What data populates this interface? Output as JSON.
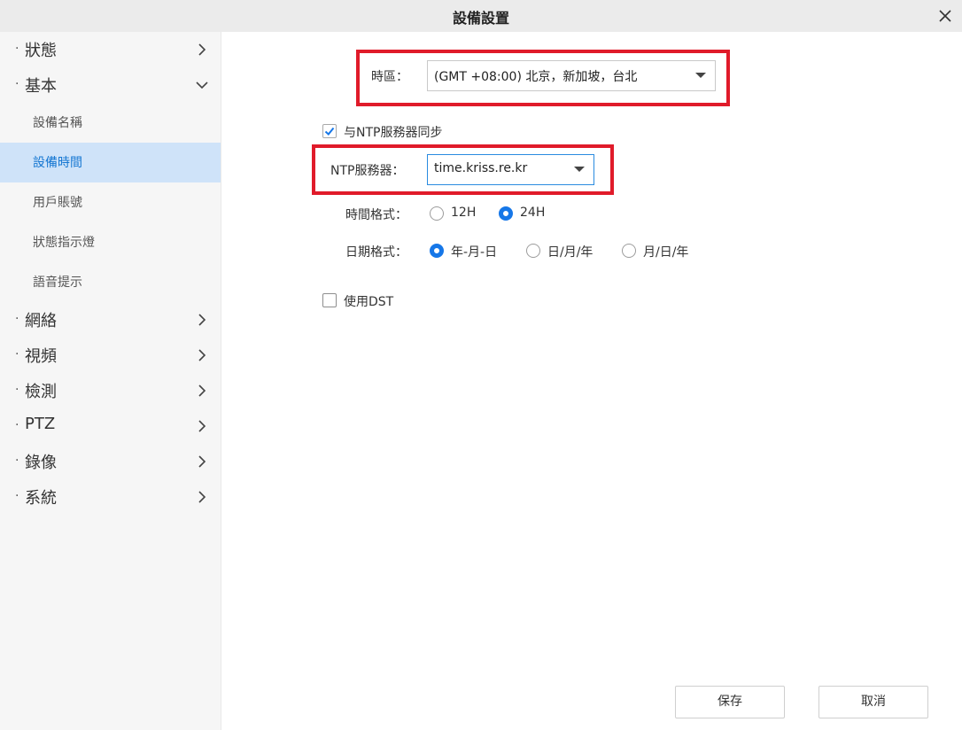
{
  "window": {
    "title": "設備設置"
  },
  "sidebar": {
    "items": [
      {
        "label": "狀態",
        "expanded": false
      },
      {
        "label": "基本",
        "expanded": true,
        "children": [
          "設備名稱",
          "設備時間",
          "用戶賬號",
          "狀態指示燈",
          "語音提示"
        ],
        "active_child": "設備時間"
      },
      {
        "label": "網絡",
        "expanded": false
      },
      {
        "label": "視頻",
        "expanded": false
      },
      {
        "label": "檢測",
        "expanded": false
      },
      {
        "label": "PTZ",
        "expanded": false
      },
      {
        "label": "錄像",
        "expanded": false
      },
      {
        "label": "系統",
        "expanded": false
      }
    ],
    "bullet": "·"
  },
  "form": {
    "timezone": {
      "label": "時區：",
      "value": "(GMT +08:00) 北京，新加坡，台北"
    },
    "ntp_sync": {
      "label": "与NTP服務器同步",
      "checked": true
    },
    "ntp_server": {
      "label": "NTP服務器：",
      "value": "time.kriss.re.kr"
    },
    "time_format": {
      "label": "時間格式：",
      "options": [
        "12H",
        "24H"
      ],
      "selected": "24H"
    },
    "date_format": {
      "label": "日期格式：",
      "options": [
        "年-月-日",
        "日/月/年",
        "月/日/年"
      ],
      "selected": "年-月-日"
    },
    "dst": {
      "label": "使用DST",
      "checked": false
    }
  },
  "buttons": {
    "save": "保存",
    "cancel": "取消"
  },
  "colors": {
    "accent": "#1677e8",
    "highlight": "#e01b2a",
    "active_bg": "#cfe3f9"
  }
}
